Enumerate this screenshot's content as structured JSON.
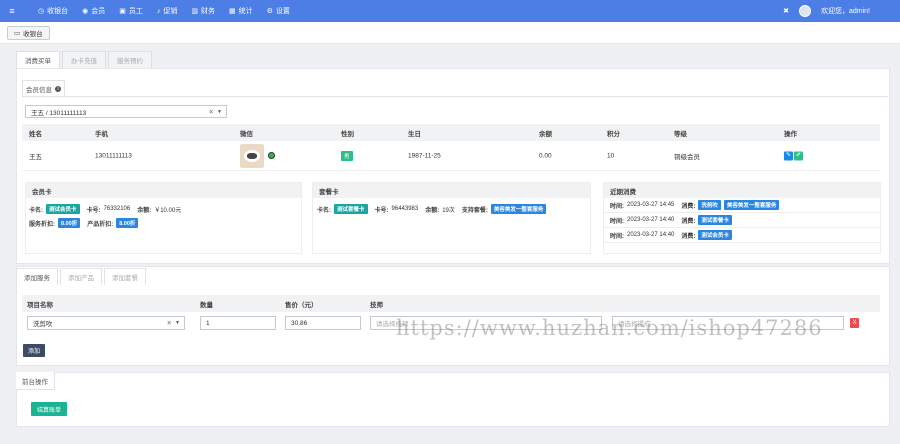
{
  "nav": {
    "items": [
      {
        "icon": "dashboard-icon",
        "label": "收银台"
      },
      {
        "icon": "user-icon",
        "label": "会员"
      },
      {
        "icon": "staff-icon",
        "label": "员工"
      },
      {
        "icon": "bell-icon",
        "label": "促销"
      },
      {
        "icon": "bank-icon",
        "label": "财务"
      },
      {
        "icon": "chart-icon",
        "label": "统计"
      },
      {
        "icon": "gears-icon",
        "label": "设置"
      }
    ],
    "welcome": "欢迎您，admin!"
  },
  "subbar": {
    "cashier_tab": "收银台"
  },
  "tabs": [
    "消费买单",
    "办卡充值",
    "服务预约"
  ],
  "member_info": {
    "label": "会员信息",
    "select_value": "王五 / 13011111113",
    "columns": [
      "姓名",
      "手机",
      "微信",
      "性别",
      "生日",
      "余额",
      "积分",
      "等级",
      "操作"
    ],
    "row": {
      "name": "王五",
      "phone": "13011111113",
      "gender": "男",
      "birthday": "1987-11-25",
      "balance": "0.00",
      "points": "10",
      "level": "铜级会员"
    }
  },
  "member_card": {
    "title": "会员卡",
    "card_name_label": "卡名:",
    "card_name": "测试会员卡",
    "card_no_label": "卡号:",
    "card_no": "76332106",
    "balance_label": "余额:",
    "balance": "￥10.00元",
    "service_discount_label": "服务折扣:",
    "service_discount": "8.00折",
    "product_discount_label": "产品折扣:",
    "product_discount": "8.00折"
  },
  "package_card": {
    "title": "套餐卡",
    "card_name_label": "卡名:",
    "card_name": "测试套餐卡",
    "card_no_label": "卡号:",
    "card_no": "96443983",
    "balance_label": "余额:",
    "balance": "19次",
    "support_label": "支持套餐:",
    "support": "美容美发一整套服务"
  },
  "recent": {
    "title": "近期消费",
    "time_label": "时间:",
    "consume_label": "消费:",
    "rows": [
      {
        "time": "2023-03-27 14:45",
        "tags": [
          "洗剪吹",
          "美容美发一整套服务"
        ]
      },
      {
        "time": "2023-03-27 14:40",
        "tags": [
          "测试套餐卡"
        ]
      },
      {
        "time": "2023-03-27 14:40",
        "tags": [
          "测试会员卡"
        ]
      }
    ]
  },
  "tabs2": [
    "添加服务",
    "添加产品",
    "添加套餐"
  ],
  "service": {
    "columns": [
      "项目名称",
      "数量",
      "售价（元）",
      "技师"
    ],
    "item": "洗剪吹",
    "qty": "1",
    "price": "30.86",
    "tech_placeholder": "请选择技师",
    "tech2_placeholder": "请选择提成",
    "delete": "X",
    "add_label": "添加"
  },
  "front_ops": {
    "tab": "前台操作",
    "button": "结算账单"
  },
  "watermark": "https://www.huzhan.com/ishop47286"
}
